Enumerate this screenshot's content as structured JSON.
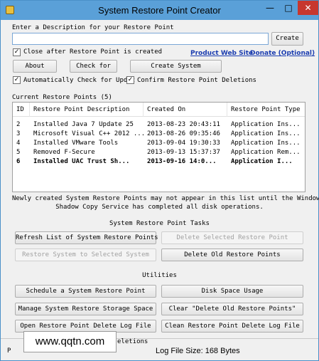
{
  "window": {
    "title": "System Restore Point Creator",
    "min_glyph": "—",
    "max_glyph": "□",
    "close_glyph": "✕"
  },
  "description": {
    "label": "Enter a Description for your Restore Point",
    "value": "",
    "create_label": "Create"
  },
  "options": {
    "close_after_create": {
      "label": "Close after Restore Point is created",
      "checked": true
    },
    "auto_check_updates": {
      "label": "Automatically Check for Updat",
      "checked": true
    },
    "confirm_deletions": {
      "label": "Confirm Restore Point Deletions",
      "checked": true
    }
  },
  "links": {
    "product_web_site": "Product Web Site",
    "donate": "Donate (Optional)"
  },
  "buttons": {
    "about": "About",
    "check_for": "Check for",
    "create_system": "Create System"
  },
  "restore_points": {
    "heading": "Current Restore Points (5)",
    "columns": [
      "ID",
      "Restore Point Description",
      "Created On",
      "Restore Point Type"
    ],
    "rows": [
      {
        "id": "2",
        "description": "Installed Java 7 Update 25",
        "created": "2013-08-23 20:43:11",
        "type": "Application Ins...",
        "bold": false
      },
      {
        "id": "3",
        "description": "Microsoft Visual C++ 2012 ...",
        "created": "2013-08-26 09:35:46",
        "type": "Application Ins...",
        "bold": false
      },
      {
        "id": "4",
        "description": "Installed VMware Tools",
        "created": "2013-09-04 19:30:33",
        "type": "Application Ins...",
        "bold": false
      },
      {
        "id": "5",
        "description": "Removed F-Secure",
        "created": "2013-09-13 15:37:37",
        "type": "Application Rem...",
        "bold": false
      },
      {
        "id": "6",
        "description": "Installed UAC Trust Sh...",
        "created": "2013-09-16 14:0...",
        "type": "Application I...",
        "bold": true
      }
    ]
  },
  "notice": {
    "line1": "Newly created System Restore Points may not appear in this list until the Windows",
    "line2": "Shadow Copy Service has completed all disk operations."
  },
  "tasks": {
    "heading": "System Restore Point Tasks",
    "refresh": "Refresh List of System Restore Points",
    "delete_selected": "Delete Selected Restore Point",
    "restore_selected": "Restore System to Selected System",
    "delete_old": "Delete Old Restore Points"
  },
  "utilities": {
    "heading": "Utilities",
    "schedule": "Schedule a System Restore Point",
    "disk_space": "Disk Space Usage",
    "manage_storage": "Manage System Restore Storage Space",
    "clear_delete_old": "Clear \"Delete Old Restore Points\"",
    "open_log": "Open Restore Point Delete Log File",
    "clean_log": "Clean Restore Point Delete Log File"
  },
  "footer": {
    "partial_left": "P",
    "partial_hidden": "eletions",
    "log_size": "Log File Size: 168 Bytes"
  },
  "watermark": "www.qqtn.com"
}
